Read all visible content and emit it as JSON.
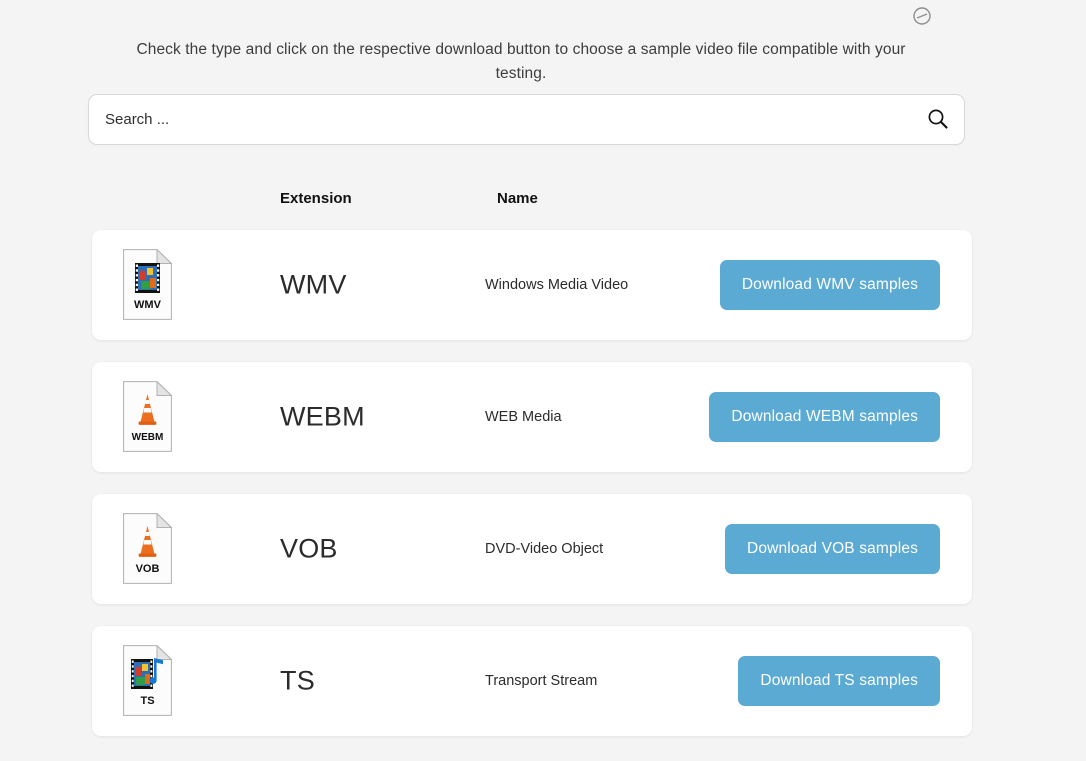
{
  "corner": {
    "icon": "circle-slash-icon"
  },
  "intro": {
    "text": "Check the type and click on the respective download button to choose a sample video file compatible with your testing."
  },
  "search": {
    "placeholder": "Search ...",
    "value": "",
    "icon": "search-icon"
  },
  "table": {
    "headers": {
      "extension": "Extension",
      "name": "Name"
    },
    "rows": [
      {
        "extension": "WMV",
        "name": "Windows Media Video",
        "button_label": "Download WMV samples",
        "icon": "film-strip-file-icon",
        "icon_caption": "WMV"
      },
      {
        "extension": "WEBM",
        "name": "WEB Media",
        "button_label": "Download WEBM samples",
        "icon": "vlc-cone-file-icon",
        "icon_caption": "WEBM"
      },
      {
        "extension": "VOB",
        "name": "DVD-Video Object",
        "button_label": "Download VOB samples",
        "icon": "vlc-cone-file-icon",
        "icon_caption": "VOB"
      },
      {
        "extension": "TS",
        "name": "Transport Stream",
        "button_label": "Download TS samples",
        "icon": "film-strip-music-note-file-icon",
        "icon_caption": "TS"
      }
    ]
  },
  "colors": {
    "page_background": "#f4f4f4",
    "card_background": "#ffffff",
    "button_accent": "#5baad4",
    "text_primary": "#2b2b2b"
  }
}
